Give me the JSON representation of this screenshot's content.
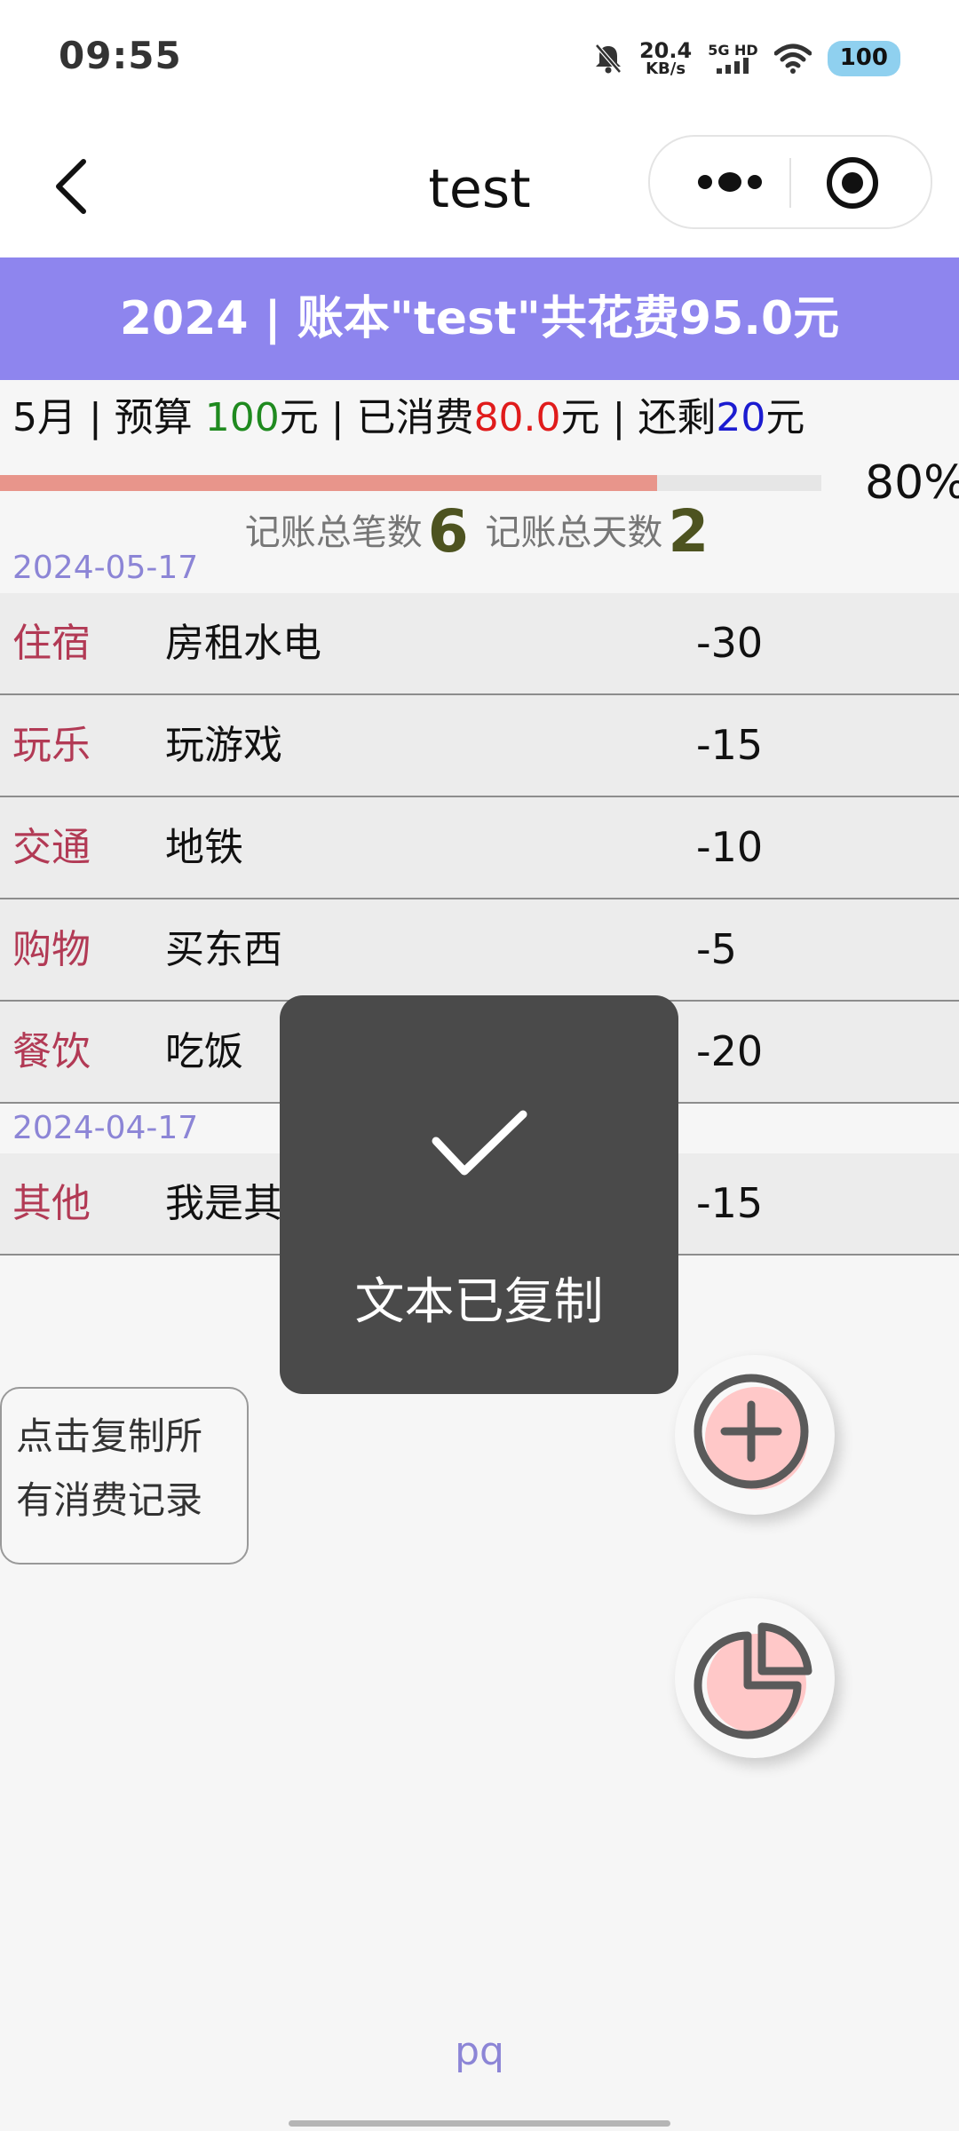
{
  "status_bar": {
    "time": "09:55",
    "net_speed_value": "20.4",
    "net_speed_unit": "KB/s",
    "signal_label": "5G HD",
    "battery": "100"
  },
  "nav": {
    "title": "test"
  },
  "banner": {
    "text": "2024 | 账本\"test\"共花费95.0元"
  },
  "budget_line": {
    "month_prefix": "5月 | 预算 ",
    "budget_value": "100",
    "budget_suffix": "元 | 已消费",
    "spent_value": "80.0",
    "spent_suffix": "元 | 还剩",
    "remaining_value": "20",
    "remaining_suffix": "元"
  },
  "progress": {
    "fraction": 0.8,
    "percent_label": "80%"
  },
  "summary": {
    "records_label": "记账总笔数",
    "records_count": "6",
    "days_label": "记账总天数",
    "days_count": "2"
  },
  "groups": [
    {
      "date": "2024-05-17",
      "rows": [
        {
          "category": "住宿",
          "description": "房租水电",
          "amount": "-30"
        },
        {
          "category": "玩乐",
          "description": "玩游戏",
          "amount": "-15"
        },
        {
          "category": "交通",
          "description": "地铁",
          "amount": "-10"
        },
        {
          "category": "购物",
          "description": "买东西",
          "amount": "-5"
        },
        {
          "category": "餐饮",
          "description": "吃饭",
          "amount": "-20"
        }
      ]
    },
    {
      "date": "2024-04-17",
      "rows": [
        {
          "category": "其他",
          "description": "我是其",
          "amount": "-15"
        }
      ]
    }
  ],
  "copy_button": {
    "label": "点击复制所有消费记录"
  },
  "toast": {
    "message": "文本已复制"
  },
  "footer": {
    "text": "pq"
  },
  "colors": {
    "banner": "#8e85ee",
    "progress_fill": "#e8958b",
    "category": "#b23a55",
    "date": "#8c85d6",
    "fab_accent": "#ffc8c8"
  },
  "icons": {
    "back": "chevron-left-icon",
    "more": "more-dots-icon",
    "target": "target-icon",
    "add": "plus-circle-icon",
    "chart": "pie-chart-icon",
    "toast": "checkmark-icon"
  }
}
